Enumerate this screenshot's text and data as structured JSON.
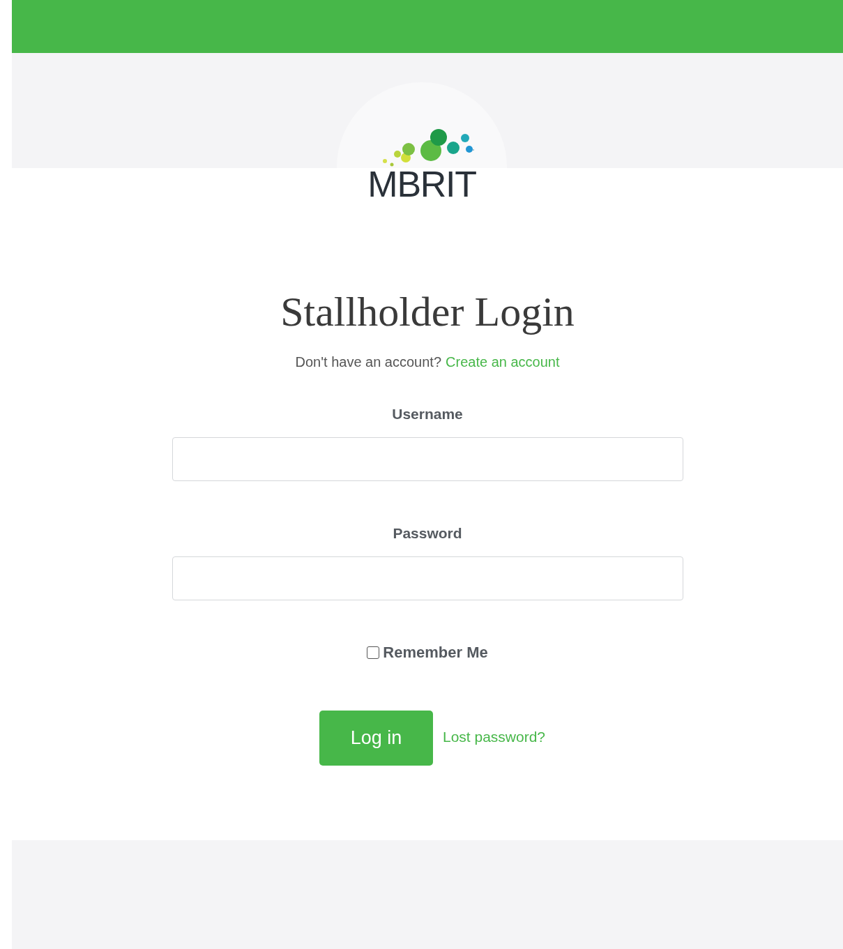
{
  "logo": {
    "text": "MBRIT"
  },
  "heading": "Stallholder Login",
  "signup": {
    "prompt": "Don't have an account?",
    "link": "Create an account"
  },
  "fields": [
    {
      "label": "Username"
    },
    {
      "label": "Password"
    }
  ],
  "remember": {
    "label": "Remember Me",
    "checked": false
  },
  "submit": "Log in",
  "lost_password": "Lost password?"
}
